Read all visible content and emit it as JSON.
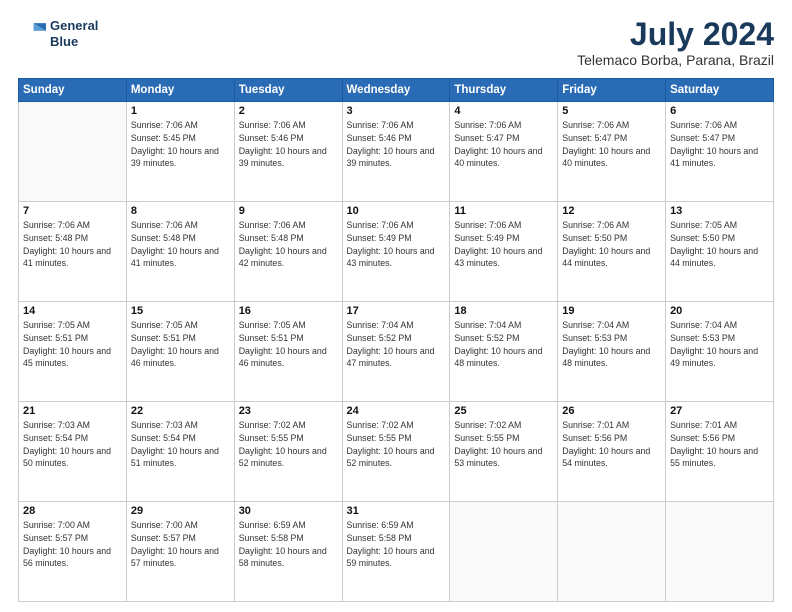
{
  "header": {
    "logo_line1": "General",
    "logo_line2": "Blue",
    "title": "July 2024",
    "subtitle": "Telemaco Borba, Parana, Brazil"
  },
  "days_of_week": [
    "Sunday",
    "Monday",
    "Tuesday",
    "Wednesday",
    "Thursday",
    "Friday",
    "Saturday"
  ],
  "weeks": [
    [
      null,
      {
        "day": 1,
        "rise": "7:06 AM",
        "set": "5:45 PM",
        "daylight": "10 hours and 39 minutes."
      },
      {
        "day": 2,
        "rise": "7:06 AM",
        "set": "5:46 PM",
        "daylight": "10 hours and 39 minutes."
      },
      {
        "day": 3,
        "rise": "7:06 AM",
        "set": "5:46 PM",
        "daylight": "10 hours and 39 minutes."
      },
      {
        "day": 4,
        "rise": "7:06 AM",
        "set": "5:47 PM",
        "daylight": "10 hours and 40 minutes."
      },
      {
        "day": 5,
        "rise": "7:06 AM",
        "set": "5:47 PM",
        "daylight": "10 hours and 40 minutes."
      },
      {
        "day": 6,
        "rise": "7:06 AM",
        "set": "5:47 PM",
        "daylight": "10 hours and 41 minutes."
      }
    ],
    [
      {
        "day": 7,
        "rise": "7:06 AM",
        "set": "5:48 PM",
        "daylight": "10 hours and 41 minutes."
      },
      {
        "day": 8,
        "rise": "7:06 AM",
        "set": "5:48 PM",
        "daylight": "10 hours and 41 minutes."
      },
      {
        "day": 9,
        "rise": "7:06 AM",
        "set": "5:48 PM",
        "daylight": "10 hours and 42 minutes."
      },
      {
        "day": 10,
        "rise": "7:06 AM",
        "set": "5:49 PM",
        "daylight": "10 hours and 43 minutes."
      },
      {
        "day": 11,
        "rise": "7:06 AM",
        "set": "5:49 PM",
        "daylight": "10 hours and 43 minutes."
      },
      {
        "day": 12,
        "rise": "7:06 AM",
        "set": "5:50 PM",
        "daylight": "10 hours and 44 minutes."
      },
      {
        "day": 13,
        "rise": "7:05 AM",
        "set": "5:50 PM",
        "daylight": "10 hours and 44 minutes."
      }
    ],
    [
      {
        "day": 14,
        "rise": "7:05 AM",
        "set": "5:51 PM",
        "daylight": "10 hours and 45 minutes."
      },
      {
        "day": 15,
        "rise": "7:05 AM",
        "set": "5:51 PM",
        "daylight": "10 hours and 46 minutes."
      },
      {
        "day": 16,
        "rise": "7:05 AM",
        "set": "5:51 PM",
        "daylight": "10 hours and 46 minutes."
      },
      {
        "day": 17,
        "rise": "7:04 AM",
        "set": "5:52 PM",
        "daylight": "10 hours and 47 minutes."
      },
      {
        "day": 18,
        "rise": "7:04 AM",
        "set": "5:52 PM",
        "daylight": "10 hours and 48 minutes."
      },
      {
        "day": 19,
        "rise": "7:04 AM",
        "set": "5:53 PM",
        "daylight": "10 hours and 48 minutes."
      },
      {
        "day": 20,
        "rise": "7:04 AM",
        "set": "5:53 PM",
        "daylight": "10 hours and 49 minutes."
      }
    ],
    [
      {
        "day": 21,
        "rise": "7:03 AM",
        "set": "5:54 PM",
        "daylight": "10 hours and 50 minutes."
      },
      {
        "day": 22,
        "rise": "7:03 AM",
        "set": "5:54 PM",
        "daylight": "10 hours and 51 minutes."
      },
      {
        "day": 23,
        "rise": "7:02 AM",
        "set": "5:55 PM",
        "daylight": "10 hours and 52 minutes."
      },
      {
        "day": 24,
        "rise": "7:02 AM",
        "set": "5:55 PM",
        "daylight": "10 hours and 52 minutes."
      },
      {
        "day": 25,
        "rise": "7:02 AM",
        "set": "5:55 PM",
        "daylight": "10 hours and 53 minutes."
      },
      {
        "day": 26,
        "rise": "7:01 AM",
        "set": "5:56 PM",
        "daylight": "10 hours and 54 minutes."
      },
      {
        "day": 27,
        "rise": "7:01 AM",
        "set": "5:56 PM",
        "daylight": "10 hours and 55 minutes."
      }
    ],
    [
      {
        "day": 28,
        "rise": "7:00 AM",
        "set": "5:57 PM",
        "daylight": "10 hours and 56 minutes."
      },
      {
        "day": 29,
        "rise": "7:00 AM",
        "set": "5:57 PM",
        "daylight": "10 hours and 57 minutes."
      },
      {
        "day": 30,
        "rise": "6:59 AM",
        "set": "5:58 PM",
        "daylight": "10 hours and 58 minutes."
      },
      {
        "day": 31,
        "rise": "6:59 AM",
        "set": "5:58 PM",
        "daylight": "10 hours and 59 minutes."
      },
      null,
      null,
      null
    ]
  ]
}
